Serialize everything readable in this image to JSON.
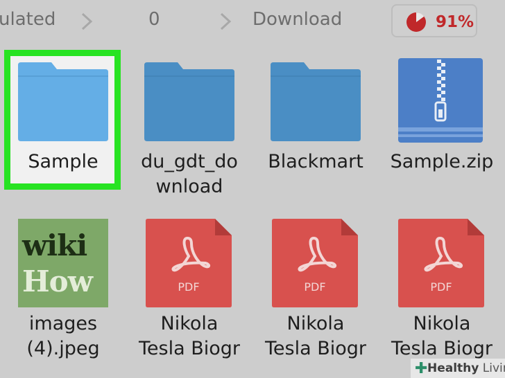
{
  "breadcrumb": {
    "items": [
      "ulated",
      "0",
      "Download"
    ]
  },
  "storage": {
    "percent_label": "91%",
    "percent_value": 91,
    "color": "#c0282a",
    "icon": "pie-chart-icon"
  },
  "files": {
    "row1": [
      {
        "label_line1": "Sample",
        "label_line2": "",
        "icon": "folder-icon",
        "selected": true
      },
      {
        "label_line1": "du_gdt_do",
        "label_line2": "wnload",
        "icon": "folder-icon"
      },
      {
        "label_line1": "Blackmart",
        "label_line2": "",
        "icon": "folder-icon"
      },
      {
        "label_line1": "Sample.zip",
        "label_line2": "",
        "icon": "zip-archive-icon"
      }
    ],
    "row2": [
      {
        "label_line1": "images",
        "label_line2": "(4).jpeg",
        "icon": "image-thumbnail",
        "thumb_line1": "wiki",
        "thumb_line2": "How"
      },
      {
        "label_line1": "Nikola",
        "label_line2": "Tesla Biogr",
        "icon": "pdf-file-icon",
        "badge": "PDF"
      },
      {
        "label_line1": "Nikola",
        "label_line2": "Tesla Biogr",
        "icon": "pdf-file-icon",
        "badge": "PDF"
      },
      {
        "label_line1": "Nikola",
        "label_line2": "Tesla Biogr",
        "icon": "pdf-file-icon",
        "badge": "PDF"
      }
    ]
  },
  "colors": {
    "selection": "#27e322",
    "folder_selected": "#64aee6",
    "folder": "#4a8ec4",
    "zip": "#4c7fc7",
    "pdf": "#d8514e"
  },
  "watermark": {
    "brand": "Healthy",
    "brand2": " Living"
  }
}
